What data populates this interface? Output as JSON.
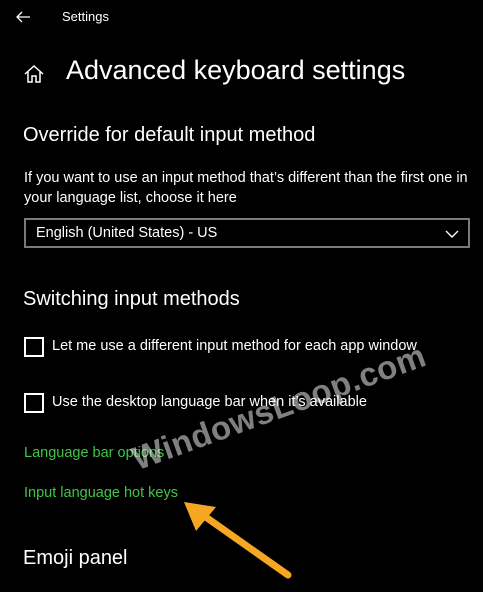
{
  "window": {
    "title": "Settings"
  },
  "page": {
    "title": "Advanced keyboard settings"
  },
  "override_section": {
    "title": "Override for default input method",
    "description": "If you want to use an input method that’s different than the first one in your language list, choose it here",
    "dropdown_value": "English (United States) - US"
  },
  "switching_section": {
    "title": "Switching input methods",
    "checkboxes": [
      {
        "label": "Let me use a different input method for each app window",
        "checked": false
      },
      {
        "label": "Use the desktop language bar when it’s available",
        "checked": false
      }
    ],
    "links": [
      {
        "label": "Language bar options"
      },
      {
        "label": "Input language hot keys"
      }
    ]
  },
  "emoji_section": {
    "title": "Emoji panel"
  },
  "watermark": {
    "text": "WindowsLoop.com"
  },
  "colors": {
    "background": "#000000",
    "text": "#ffffff",
    "link": "#3fc54b",
    "annotation_arrow": "#f5a623"
  },
  "icons": {
    "back": "back-arrow-icon",
    "home": "home-icon",
    "dropdown": "chevron-down-icon"
  }
}
